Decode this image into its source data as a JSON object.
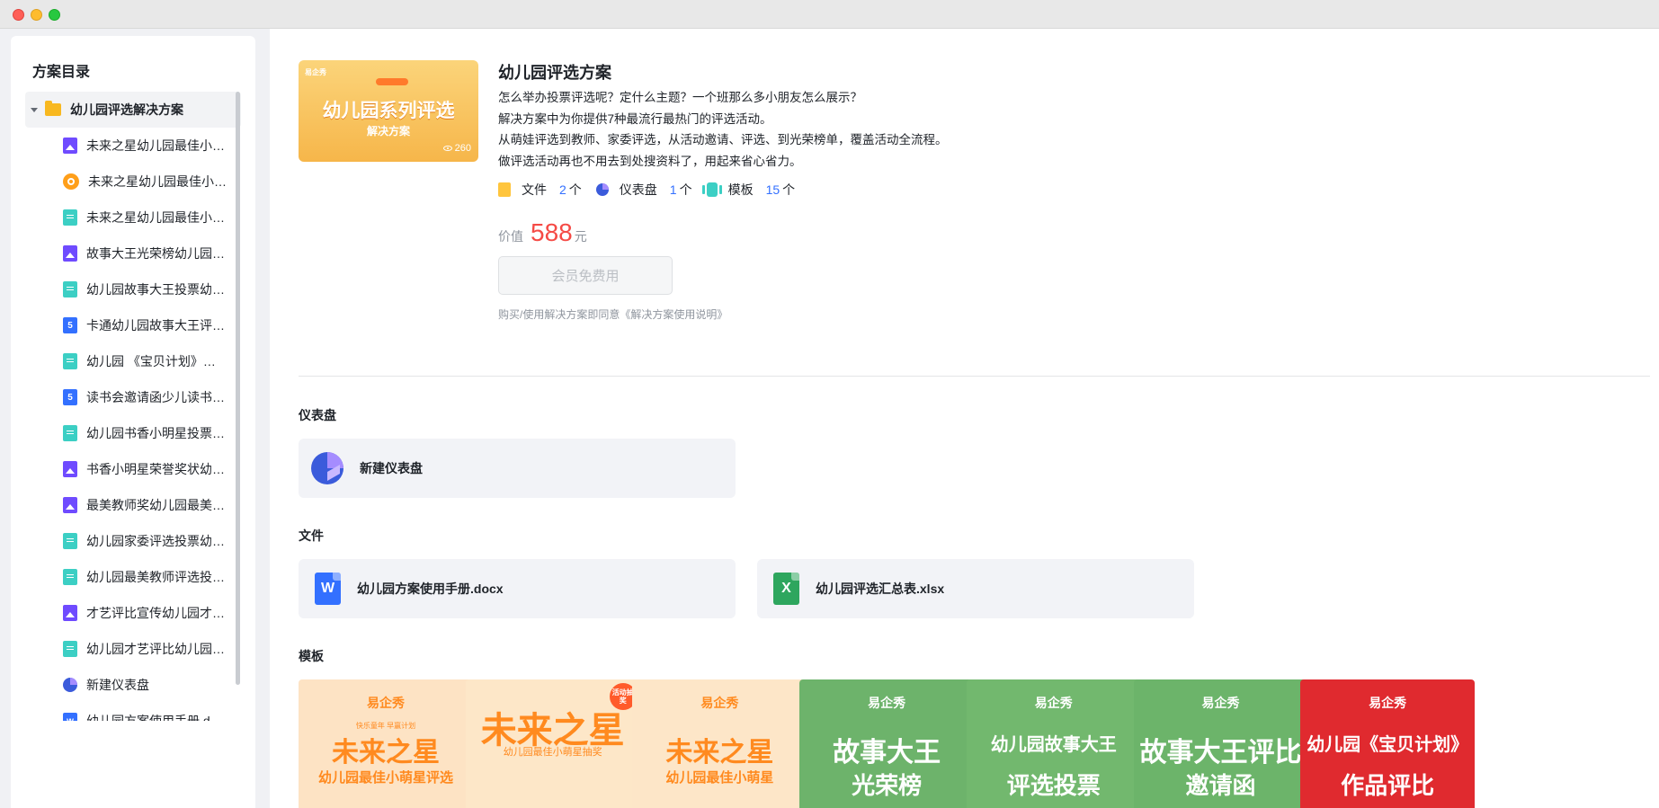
{
  "sidebar": {
    "title": "方案目录",
    "root": "幼儿园评选解决方案",
    "items": [
      {
        "type": "image",
        "label": "未来之星幼儿园最佳小…"
      },
      {
        "type": "wheel",
        "label": "未来之星幼儿园最佳小…"
      },
      {
        "type": "form",
        "label": "未来之星幼儿园最佳小…"
      },
      {
        "type": "image",
        "label": "故事大王光荣榜幼儿园…"
      },
      {
        "type": "form",
        "label": "幼儿园故事大王投票幼…"
      },
      {
        "type": "h5",
        "label": "卡通幼儿园故事大王评…"
      },
      {
        "type": "form",
        "label": "幼儿园 《宝贝计划》…"
      },
      {
        "type": "h5",
        "label": "读书会邀请函少儿读书…"
      },
      {
        "type": "form",
        "label": "幼儿园书香小明星投票…"
      },
      {
        "type": "image",
        "label": "书香小明星荣誉奖状幼…"
      },
      {
        "type": "image",
        "label": "最美教师奖幼儿园最美…"
      },
      {
        "type": "form",
        "label": "幼儿园家委评选投票幼…"
      },
      {
        "type": "form",
        "label": "幼儿园最美教师评选投…"
      },
      {
        "type": "image",
        "label": "才艺评比宣传幼儿园才…"
      },
      {
        "type": "form",
        "label": "幼儿园才艺评比幼儿园…"
      },
      {
        "type": "dash",
        "label": "新建仪表盘"
      },
      {
        "type": "word",
        "label": "幼儿园方案使用手册.d…"
      }
    ]
  },
  "cover": {
    "brand": "易企秀",
    "title": "幼儿园系列评选",
    "subtitle": "解决方案",
    "views": "260"
  },
  "info": {
    "title": "幼儿园评选方案",
    "desc": [
      "怎么举办投票评选呢？定什么主题？一个班那么多小朋友怎么展示？",
      "解决方案中为你提供7种最流行最热门的评选活动。",
      "从萌娃评选到教师、家委评选，从活动邀请、评选、到光荣榜单，覆盖活动全流程。",
      "做评选活动再也不用去到处搜资料了，用起来省心省力。"
    ],
    "stats": [
      {
        "icon": "file",
        "name": "文件",
        "count": "2",
        "unit": "个"
      },
      {
        "icon": "pie",
        "name": "仪表盘",
        "count": "1",
        "unit": "个"
      },
      {
        "icon": "tmpl",
        "name": "模板",
        "count": "15",
        "unit": "个"
      }
    ],
    "price_label": "价值",
    "price_value": "588",
    "price_unit": "元",
    "button": "会员免费用",
    "agree": "购买/使用解决方案即同意《解决方案使用说明》"
  },
  "sections": {
    "dashboard_title": "仪表盘",
    "dashboard_card": "新建仪表盘",
    "files_title": "文件",
    "files": [
      {
        "icon": "W",
        "kind": "word",
        "name": "幼儿园方案使用手册.docx"
      },
      {
        "icon": "X",
        "kind": "excel",
        "name": "幼儿园评选汇总表.xlsx"
      }
    ],
    "templates_title": "模板"
  },
  "templates": [
    {
      "brand": "易企秀",
      "small": "快乐童年 早赢计划",
      "line1": "未来之星",
      "line2": "幼儿园最佳小萌星评选",
      "bg": "#fde3c4",
      "fg": "#ff8a1f"
    },
    {
      "brand": "",
      "small": "幼儿园最佳小萌星抽奖",
      "line1": "未来之星",
      "line2": "",
      "tag": "活动抽奖",
      "bg": "#fde7c8",
      "fg": "#ff8a1f"
    },
    {
      "brand": "易企秀",
      "small": "",
      "line1": "未来之星",
      "line2": "幼儿园最佳小萌星",
      "bg": "#fde6c8",
      "fg": "#ff8a1f"
    },
    {
      "brand": "易企秀",
      "small": "",
      "line1": "故事大王",
      "line2": "光荣榜",
      "bg": "#6db36b",
      "fg": "#ffffff"
    },
    {
      "brand": "易企秀",
      "small": "",
      "line1": "幼儿园故事大王",
      "line2": "评选投票",
      "bg": "#72b86e",
      "fg": "#ffffff"
    },
    {
      "brand": "易企秀",
      "small": "",
      "line1": "故事大王评比",
      "line2": "邀请函",
      "bg": "#6cb46a",
      "fg": "#ffffff"
    },
    {
      "brand": "易企秀",
      "small": "",
      "line1": "幼儿园《宝贝计划》",
      "line2": "作品评比",
      "bg": "#e02a2f",
      "fg": "#ffffff"
    }
  ]
}
